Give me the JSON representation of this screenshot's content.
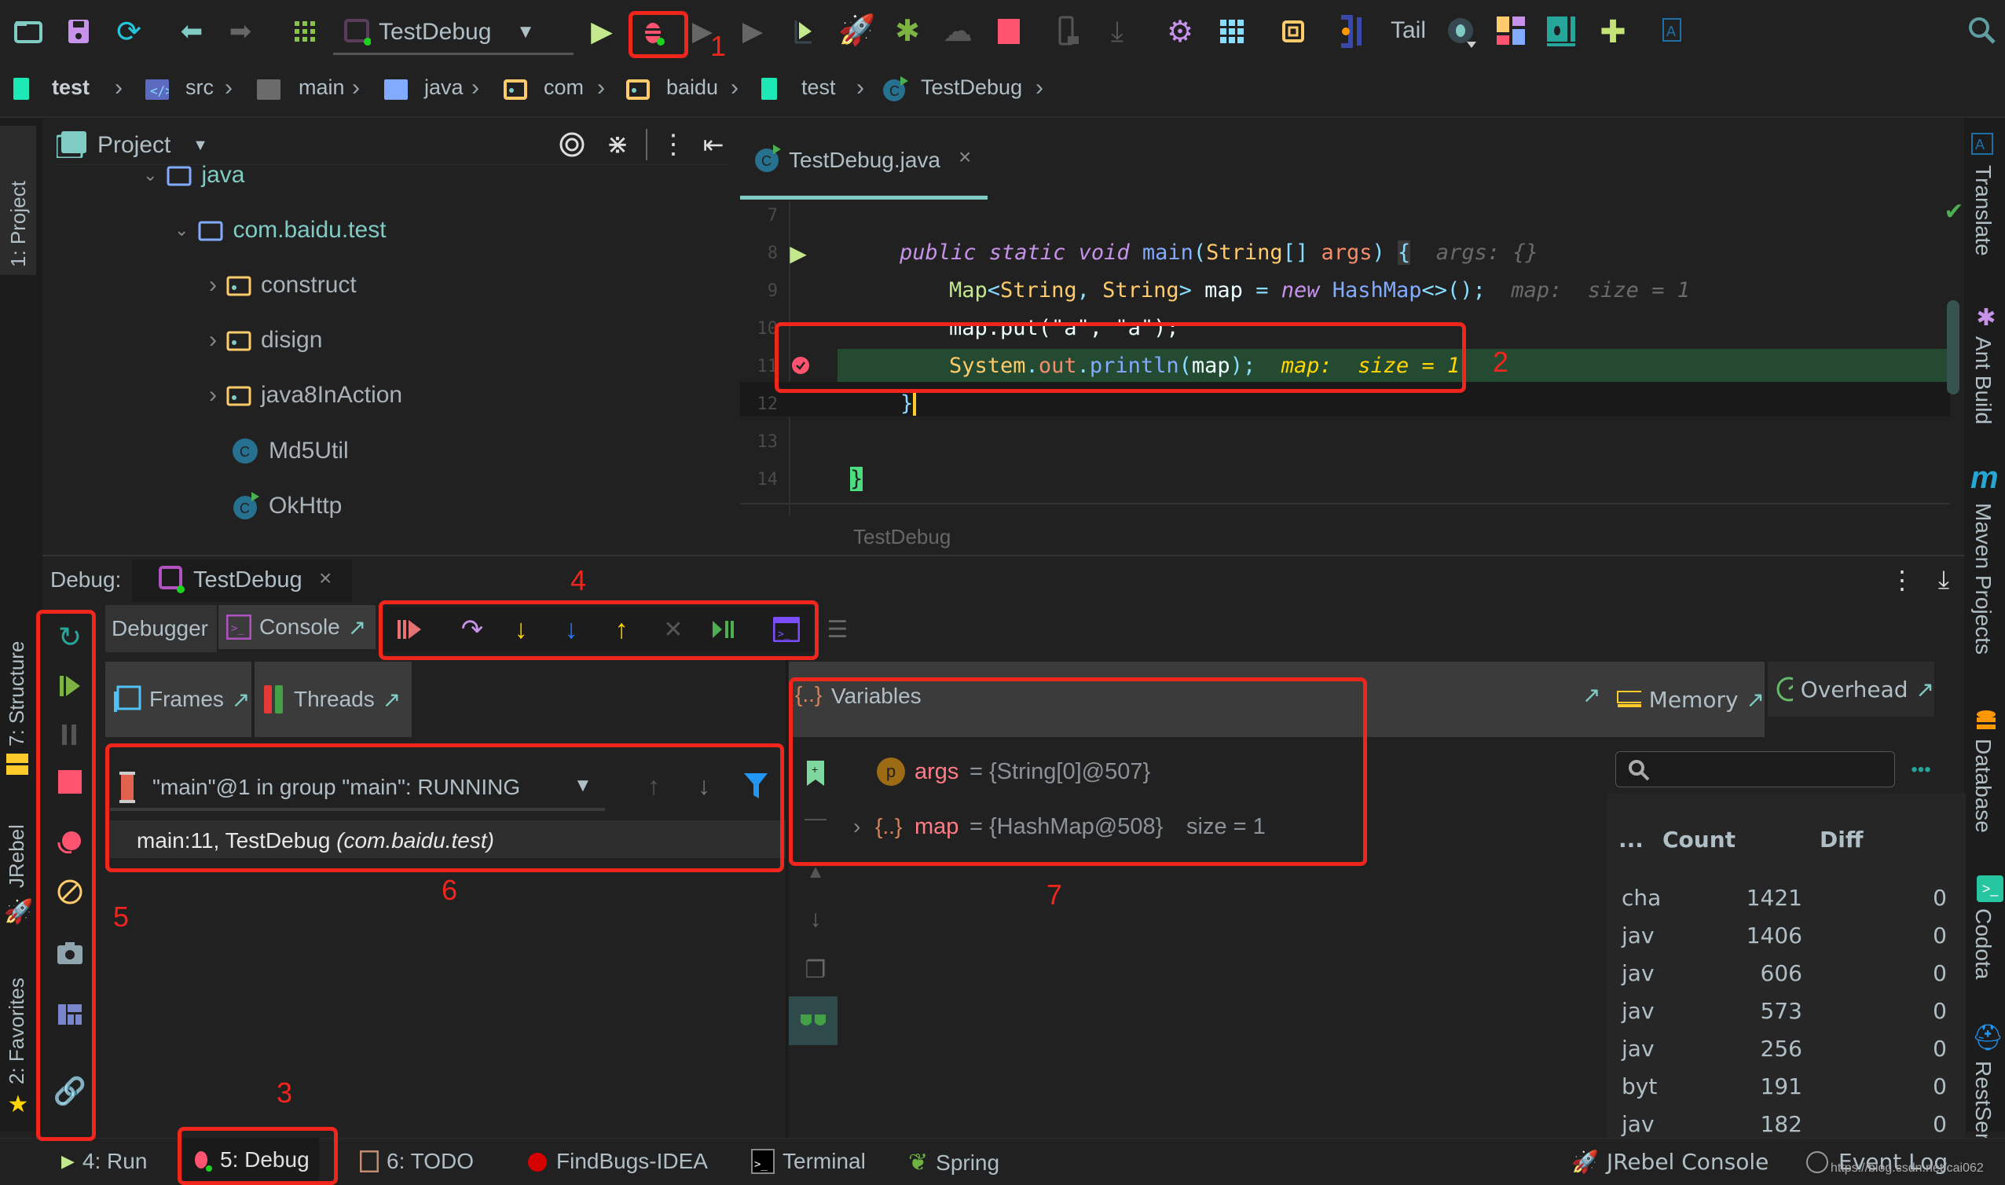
{
  "toolbar": {
    "run_config": "TestDebug",
    "tail_label": "Tail",
    "icons": [
      "open-folder-icon",
      "save-icon",
      "sync-icon",
      "back-icon",
      "forward-icon",
      "grid-icon",
      "run-config-icon",
      "dropdown-icon",
      "run-icon",
      "debug-icon",
      "run-coverage-icon",
      "profile-icon",
      "jrebel-run-icon",
      "jrebel-debug-icon",
      "deploy-icon",
      "stop-icon",
      "android-device-icon",
      "android-download-icon",
      "settings-icon",
      "project-structure-icon",
      "chip-icon",
      "jclasslib-icon",
      "tail-icon",
      "sonar-icon",
      "layout-icon",
      "book-icon",
      "plugin-icon",
      "translate-icon",
      "search-icon"
    ]
  },
  "breadcrumb": [
    "test",
    "src",
    "main",
    "java",
    "com",
    "baidu",
    "test",
    "TestDebug"
  ],
  "left_strip": {
    "project": "1: Project",
    "structure": "7: Structure",
    "jrebel": "JRebel",
    "favorites": "2: Favorites"
  },
  "right_strip": [
    "Translate",
    "Ant Build",
    "Maven Projects",
    "Database",
    "Codota",
    "RestSer"
  ],
  "project_panel": {
    "title": "Project",
    "tree": [
      {
        "label": "java",
        "type": "folder",
        "expanded": true,
        "depth": 0
      },
      {
        "label": "com.baidu.test",
        "type": "package",
        "expanded": true,
        "depth": 1
      },
      {
        "label": "construct",
        "type": "package",
        "expanded": false,
        "depth": 2
      },
      {
        "label": "disign",
        "type": "package",
        "expanded": false,
        "depth": 2
      },
      {
        "label": "java8InAction",
        "type": "package",
        "expanded": false,
        "depth": 2
      },
      {
        "label": "Md5Util",
        "type": "class",
        "depth": 2
      },
      {
        "label": "OkHttp",
        "type": "class-runnable",
        "depth": 2
      }
    ]
  },
  "editor": {
    "tab": "TestDebug.java",
    "footer": "TestDebug",
    "line_numbers": [
      "7",
      "8",
      "9",
      "10",
      "11",
      "12",
      "13",
      "14"
    ],
    "lines": {
      "l8": {
        "kw": "public static void ",
        "fn": "main",
        "p1": "(",
        "type": "String",
        "br": "[] ",
        "arg": "args",
        "p2": ") ",
        "brace": "{",
        "hint": "  args: {}"
      },
      "l9": {
        "type1": "Map",
        "lt": "<",
        "t2": "String",
        "c": ", ",
        "t3": "String",
        "gt": "> ",
        "var": "map ",
        "eq": "= ",
        "new": "new ",
        "cls": "HashMap",
        "rest": "<>();",
        "hint": "  map:  size = 1"
      },
      "l10": "map.put(\"a\", \"a\");",
      "l11": {
        "sys": "System",
        "dot": ".",
        "out": "out",
        "dot2": ".",
        "fn": "println",
        "open": "(",
        "arg": "map",
        "close": ");",
        "hint": "  map:  size = 1"
      },
      "l12": "}",
      "l14": "}"
    }
  },
  "debug": {
    "label": "Debug:",
    "session": "TestDebug",
    "tabs": {
      "debugger": "Debugger",
      "console": "Console"
    },
    "frames_tab": "Frames",
    "threads_tab": "Threads",
    "variables_tab": "Variables",
    "memory_tab": "Memory",
    "overhead_tab": "Overhead",
    "thread_select": "\"main\"@1 in group \"main\": RUNNING",
    "frame": {
      "method": "main:11, TestDebug ",
      "pkg": "(com.baidu.test)"
    },
    "variables": [
      {
        "name": "args",
        "value": "= {String[0]@507}",
        "icon": "p"
      },
      {
        "name": "map",
        "value": "= {HashMap@508}",
        "extra": "size = 1",
        "icon": "{...}"
      }
    ],
    "memory": {
      "search_placeholder": "",
      "headers": {
        "name": "...",
        "count": "Count",
        "diff": "Diff"
      },
      "rows": [
        {
          "name": "cha",
          "count": "1421",
          "diff": "0"
        },
        {
          "name": "jav",
          "count": "1406",
          "diff": "0"
        },
        {
          "name": "jav",
          "count": "606",
          "diff": "0"
        },
        {
          "name": "jav",
          "count": "573",
          "diff": "0"
        },
        {
          "name": "jav",
          "count": "256",
          "diff": "0"
        },
        {
          "name": "byt",
          "count": "191",
          "diff": "0"
        },
        {
          "name": "jav",
          "count": "182",
          "diff": "0"
        }
      ]
    }
  },
  "statusbar": {
    "run": "4: Run",
    "debug": "5: Debug",
    "todo": "6: TODO",
    "findbugs": "FindBugs-IDEA",
    "terminal": "Terminal",
    "spring": "Spring",
    "jrebel_console": "JRebel Console",
    "event_log": "Event Log",
    "watermark": "https://blog.csdn.net/cai062"
  },
  "annotations": [
    "1",
    "2",
    "3",
    "4",
    "5",
    "6",
    "7"
  ],
  "colors": {
    "accent_red": "#f0261c",
    "exec_line": "#254a32",
    "bg": "#212121"
  }
}
